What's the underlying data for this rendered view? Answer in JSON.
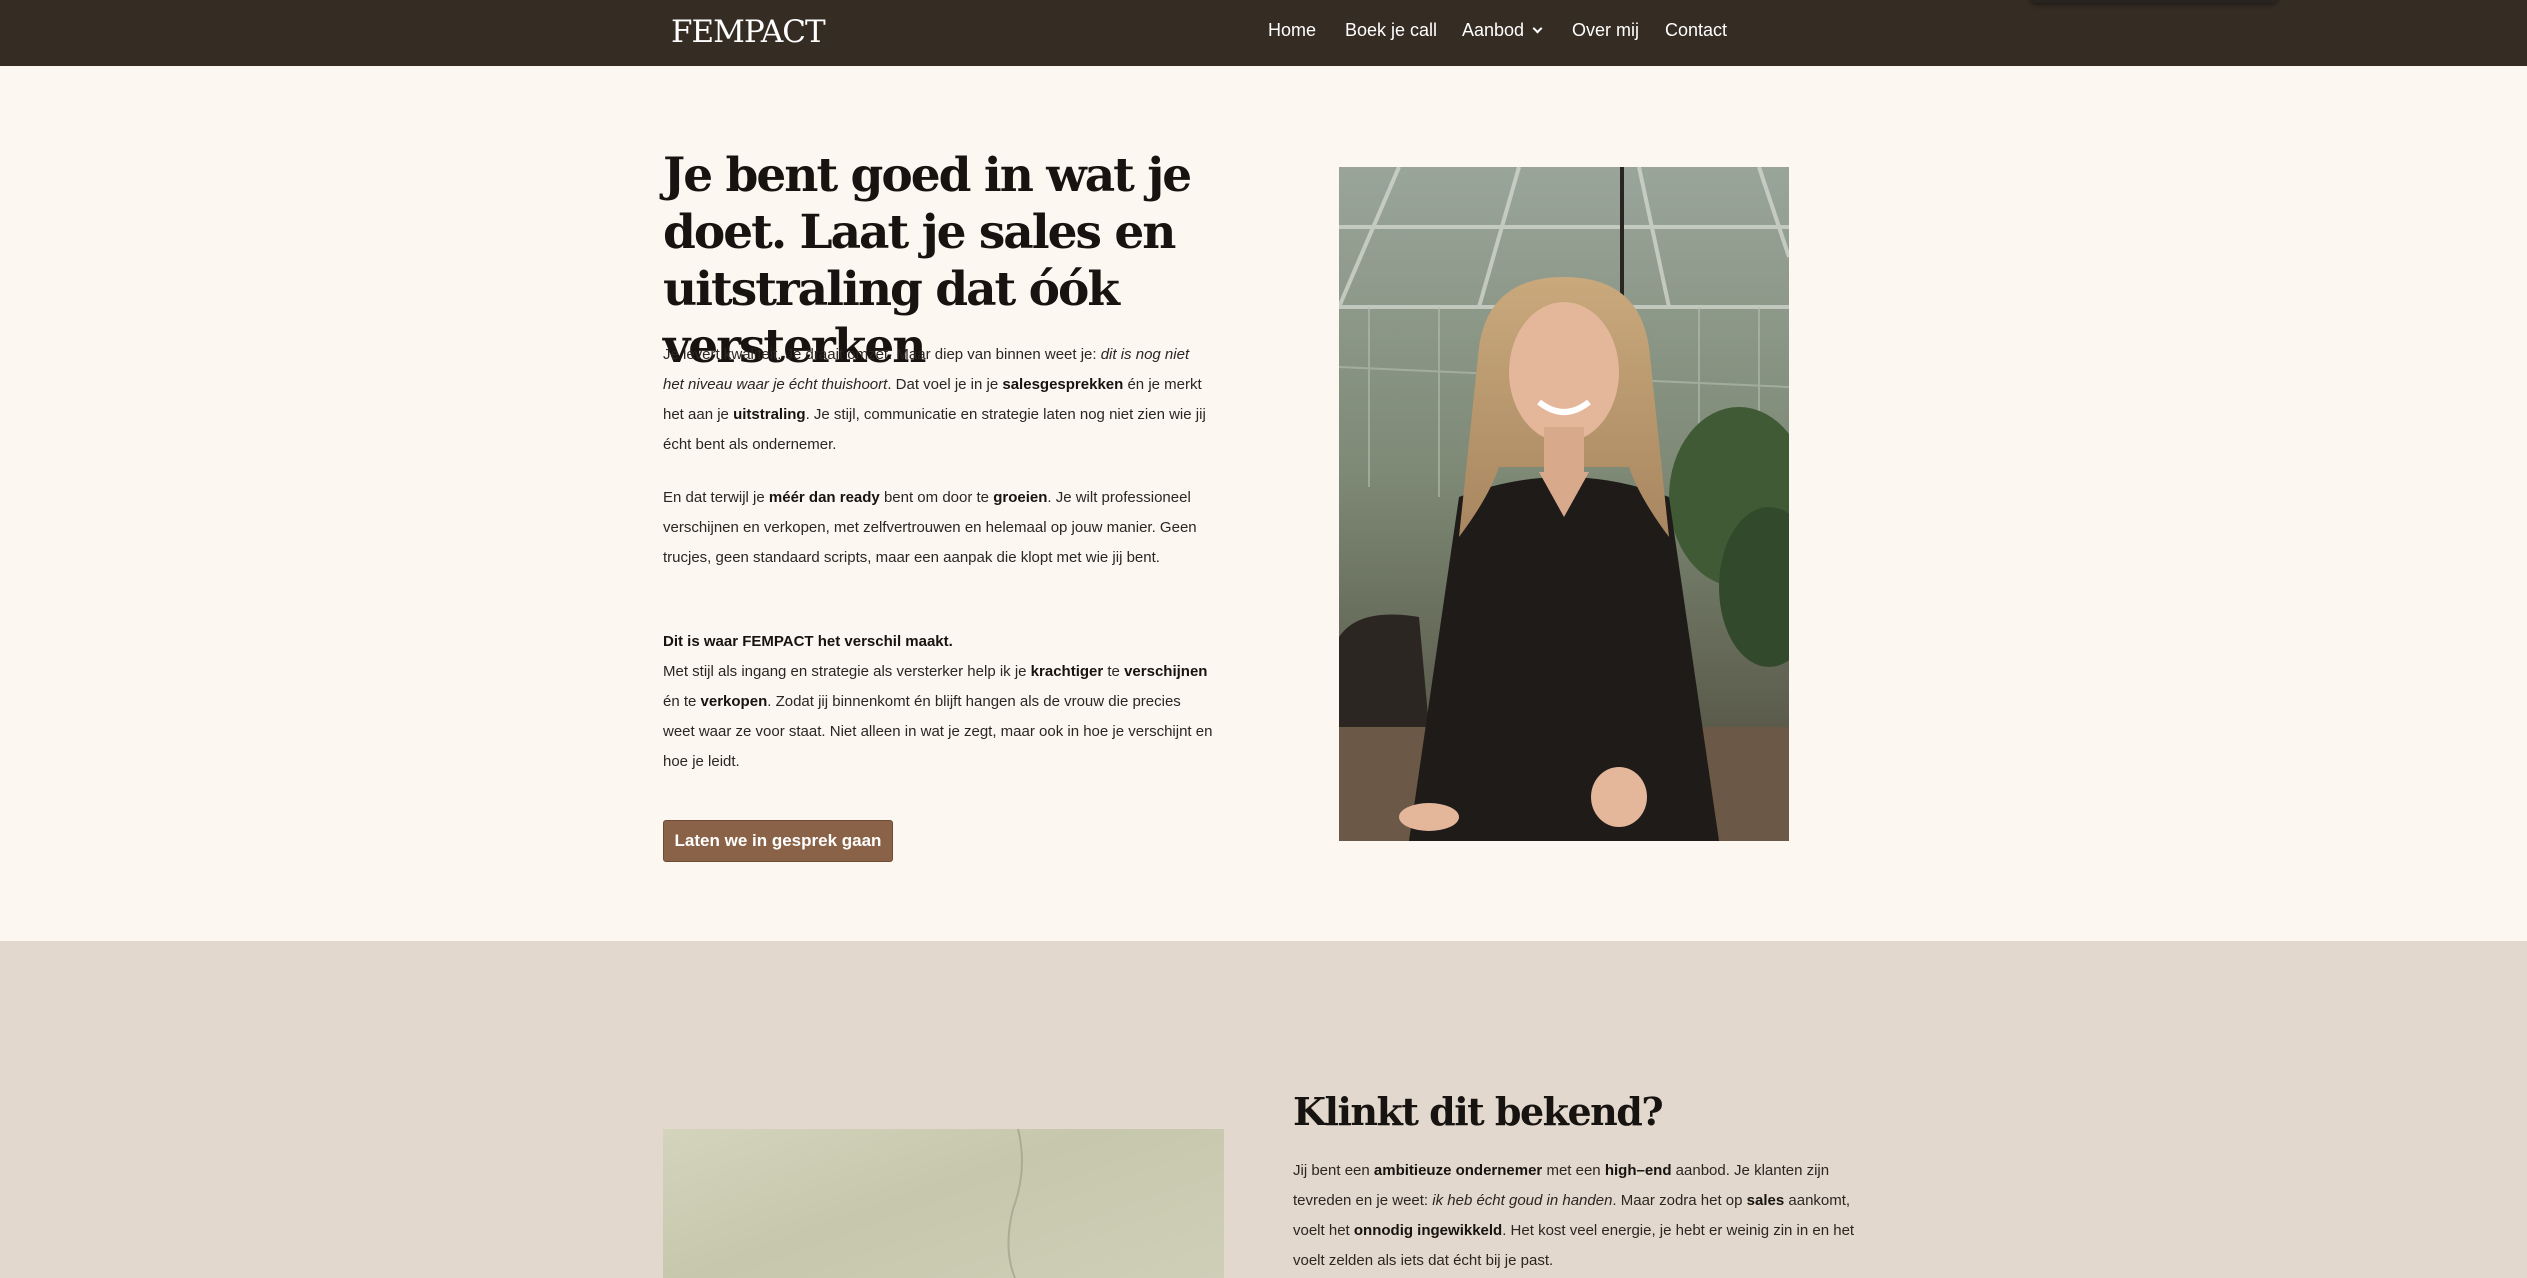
{
  "header": {
    "logo": "FEMPACT",
    "nav": [
      {
        "label": "Home"
      },
      {
        "label": "Boek je call"
      },
      {
        "label": "Aanbod"
      },
      {
        "label": "Over mij"
      },
      {
        "label": "Contact"
      }
    ]
  },
  "hero": {
    "title": "Je bent goed in wat je doet. Laat je sales en uitstraling dat óók versterken",
    "p1": {
      "a": "Je levert kwaliteit. Je draait omzet. Maar diep van binnen weet je: ",
      "b_italic": "dit is nog niet het niveau waar je écht thuishoort",
      "c": ". Dat voel je in je ",
      "d_bold": "salesgesprekken",
      "e": " én je merkt het aan je ",
      "f_bold": "uitstraling",
      "g": ". Je stijl, communicatie en strategie laten nog niet zien wie jij écht bent als ondernemer."
    },
    "p2": {
      "a": "En dat terwijl je ",
      "b_bold": "méér dan ready",
      "c": " bent om door te ",
      "d_bold": "groeien",
      "e": ". Je wilt professioneel verschijnen en verkopen, met zelfvertrouwen en helemaal op jouw manier. Geen trucjes, geen standaard scripts, maar een aanpak die klopt met wie jij bent."
    },
    "p3": {
      "heading_bold": "Dit is waar FEMPACT het verschil maakt.",
      "a": "Met stijl als ingang en strategie als versterker help ik je ",
      "b_bold": "krachtiger",
      "c": " te ",
      "d_bold": "verschijnen",
      "e": " én te ",
      "f_bold": "verkopen",
      "g": ". Zodat jij binnenkomt én blijft hangen als de vrouw die precies weet waar ze voor staat. Niet alleen in wat je zegt, maar ook in hoe je verschijnt en hoe je leidt."
    },
    "cta_label": "Laten we in gesprek gaan"
  },
  "section2": {
    "title": "Klinkt dit bekend?",
    "p1": {
      "a": "Jij bent een ",
      "b_bold": "ambitieuze ondernemer",
      "c": " met een ",
      "d_bold": "high–end",
      "e": " aanbod. Je klanten zijn tevreden en je weet: ",
      "f_italic": "ik heb écht goud in handen",
      "g": ". Maar zodra het op ",
      "h_bold": "sales",
      "i": " aankomt, voelt het ",
      "j_bold": "onnodig ingewikkeld",
      "k": ". Het kost veel energie, je hebt er weinig zin in en het voelt zelden als iets dat écht bij je past."
    }
  },
  "colors": {
    "nav_bg": "#352c24",
    "page_bg": "#fcf7f0",
    "section2_bg": "#e3d8cd",
    "cta_bg": "#8a6247"
  }
}
